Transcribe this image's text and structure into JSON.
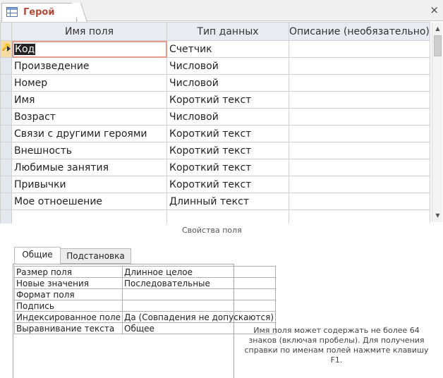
{
  "tab": {
    "title": "Герой",
    "icon": "table-icon",
    "close": "×"
  },
  "grid": {
    "headers": [
      "Имя поля",
      "Тип данных",
      "Описание (необязательно)"
    ],
    "rows": [
      {
        "name": "Код",
        "type": "Счетчик",
        "desc": ""
      },
      {
        "name": "Произведение",
        "type": "Числовой",
        "desc": ""
      },
      {
        "name": "Номер",
        "type": "Числовой",
        "desc": ""
      },
      {
        "name": "Имя",
        "type": "Короткий текст",
        "desc": ""
      },
      {
        "name": "Возраст",
        "type": "Числовой",
        "desc": ""
      },
      {
        "name": "Связи с другими героями",
        "type": "Короткий текст",
        "desc": ""
      },
      {
        "name": "Внешность",
        "type": "Короткий текст",
        "desc": ""
      },
      {
        "name": "Любимые занятия",
        "type": "Короткий текст",
        "desc": ""
      },
      {
        "name": "Привычки",
        "type": "Короткий текст",
        "desc": ""
      },
      {
        "name": "Мое отноешение",
        "type": "Длинный текст",
        "desc": ""
      },
      {
        "name": "",
        "type": "",
        "desc": ""
      }
    ]
  },
  "properties": {
    "section_label": "Свойства поля",
    "tabs": [
      "Общие",
      "Подстановка"
    ],
    "rows": [
      {
        "name": "Размер поля",
        "value": "Длинное целое"
      },
      {
        "name": "Новые значения",
        "value": "Последовательные"
      },
      {
        "name": "Формат поля",
        "value": ""
      },
      {
        "name": "Подпись",
        "value": ""
      },
      {
        "name": "Индексированное поле",
        "value": "Да (Совпадения не допускаются)"
      },
      {
        "name": "Выравнивание текста",
        "value": "Общее"
      }
    ]
  },
  "help": {
    "text": "Имя поля может содержать не более 64 знаков (включая пробелы). Для получения справки по именам полей нажмите клавишу F1."
  },
  "colors": {
    "tab_title": "#b24a3a",
    "header_bg": "#e8ecf2",
    "selector_active": "#f6dca2",
    "active_cell_outline": "#e79a8d"
  }
}
